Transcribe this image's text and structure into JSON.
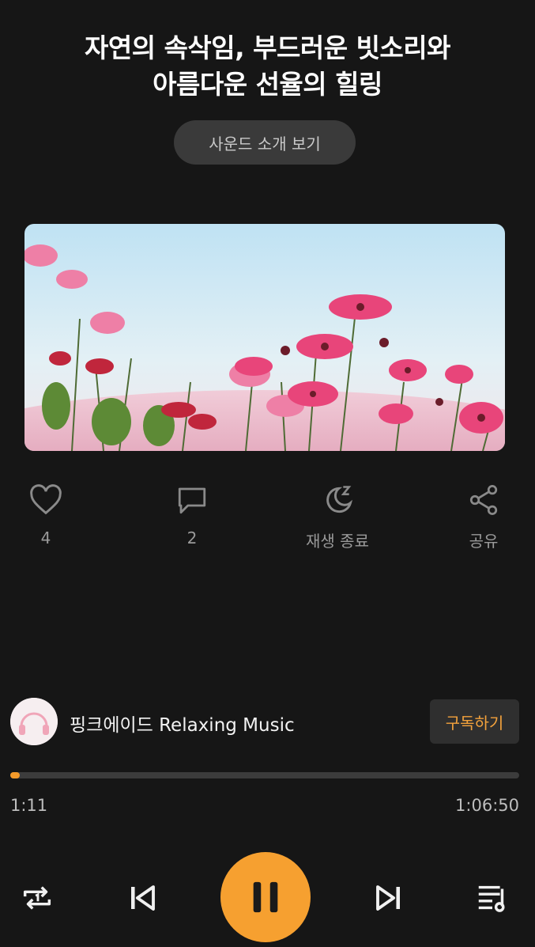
{
  "title": {
    "line1": "자연의 속삭임, 부드러운 빗소리와",
    "line2": "아름다운 선율의 힐링"
  },
  "intro_button": "사운드 소개 보기",
  "actions": {
    "like_count": "4",
    "comment_count": "2",
    "sleep_label": "재생 종료",
    "share_label": "공유"
  },
  "channel": {
    "name": "핑크에이드 Relaxing Music",
    "subscribe_label": "구독하기"
  },
  "player": {
    "current_time": "1:11",
    "total_time": "1:06:50",
    "progress_fraction": 0.018
  },
  "colors": {
    "accent": "#f6a030",
    "background": "#161616"
  },
  "icons": [
    "heart-icon",
    "comment-icon",
    "moon-sleep-icon",
    "share-icon",
    "repeat-one-icon",
    "skip-previous-icon",
    "pause-icon",
    "skip-next-icon",
    "playlist-icon"
  ]
}
